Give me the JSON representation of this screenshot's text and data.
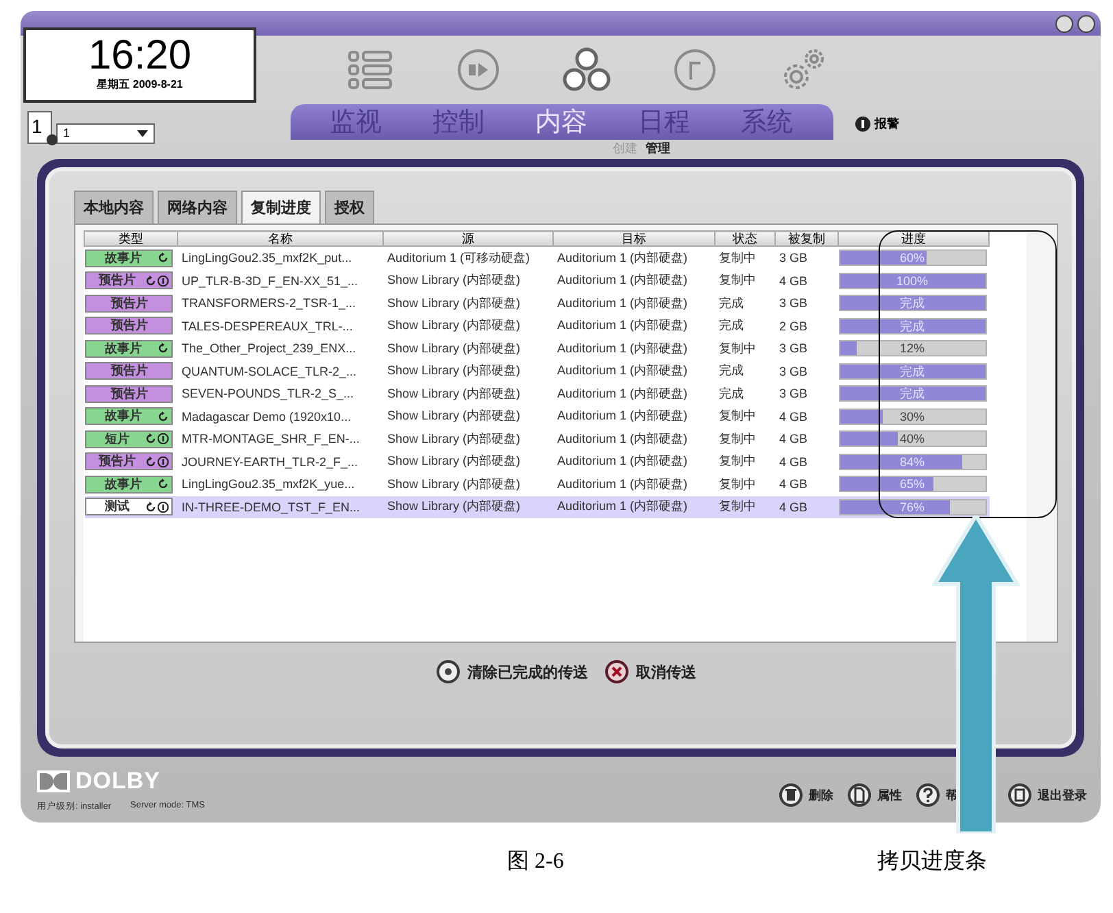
{
  "clock": {
    "time": "16:20",
    "date": "星期五 2009-8-21"
  },
  "screen_selector": {
    "number": "1",
    "value": "1"
  },
  "nav": [
    {
      "label": "监视",
      "kind": "list",
      "selected": false
    },
    {
      "label": "控制",
      "kind": "play",
      "selected": false
    },
    {
      "label": "内容",
      "kind": "content",
      "selected": true
    },
    {
      "label": "日程",
      "kind": "schedule",
      "selected": false
    },
    {
      "label": "系统",
      "kind": "settings",
      "selected": false
    }
  ],
  "sub_tabs": [
    {
      "label": "创建",
      "selected": false
    },
    {
      "label": "管理",
      "selected": true
    }
  ],
  "alarm": {
    "label": "报警"
  },
  "content_tabs": [
    {
      "label": "本地内容",
      "selected": false
    },
    {
      "label": "网络内容",
      "selected": false
    },
    {
      "label": "复制进度",
      "selected": true
    },
    {
      "label": "授权",
      "selected": false
    }
  ],
  "table": {
    "columns": [
      "类型",
      "名称",
      "源",
      "目标",
      "状态",
      "被复制",
      "进度"
    ],
    "rows": [
      {
        "type": "故事片",
        "color": "#86d68f",
        "loop": true,
        "info": false,
        "name": "LingLingGou2.35_mxf2K_put...",
        "source": "Auditorium 1 (可移动硬盘)",
        "target": "Auditorium 1 (内部硬盘)",
        "status": "复制中",
        "copied": "3 GB",
        "progress": "60%",
        "level": 0.6,
        "selected": false
      },
      {
        "type": "预告片",
        "color": "#c58fe0",
        "loop": true,
        "info": true,
        "name": "UP_TLR-B-3D_F_EN-XX_51_...",
        "source": "Show Library (内部硬盘)",
        "target": "Auditorium 1 (内部硬盘)",
        "status": "复制中",
        "copied": "4 GB",
        "progress": "100%",
        "level": 1,
        "selected": false
      },
      {
        "type": "预告片",
        "color": "#c58fe0",
        "loop": false,
        "info": false,
        "name": "TRANSFORMERS-2_TSR-1_...",
        "source": "Show Library (内部硬盘)",
        "target": "Auditorium 1 (内部硬盘)",
        "status": "完成",
        "copied": "3 GB",
        "progress": "完成",
        "level": 1,
        "selected": false
      },
      {
        "type": "预告片",
        "color": "#c58fe0",
        "loop": false,
        "info": false,
        "name": "TALES-DESPEREAUX_TRL-...",
        "source": "Show Library (内部硬盘)",
        "target": "Auditorium 1 (内部硬盘)",
        "status": "完成",
        "copied": "2 GB",
        "progress": "完成",
        "level": 1,
        "selected": false
      },
      {
        "type": "故事片",
        "color": "#86d68f",
        "loop": true,
        "info": false,
        "name": "The_Other_Project_239_ENX...",
        "source": "Show Library (内部硬盘)",
        "target": "Auditorium 1 (内部硬盘)",
        "status": "复制中",
        "copied": "3 GB",
        "progress": "12%",
        "level": 0.12,
        "selected": false
      },
      {
        "type": "预告片",
        "color": "#c58fe0",
        "loop": false,
        "info": false,
        "name": "QUANTUM-SOLACE_TLR-2_...",
        "source": "Show Library (内部硬盘)",
        "target": "Auditorium 1 (内部硬盘)",
        "status": "完成",
        "copied": "3 GB",
        "progress": "完成",
        "level": 1,
        "selected": false
      },
      {
        "type": "预告片",
        "color": "#c58fe0",
        "loop": false,
        "info": false,
        "name": "SEVEN-POUNDS_TLR-2_S_...",
        "source": "Show Library (内部硬盘)",
        "target": "Auditorium 1 (内部硬盘)",
        "status": "完成",
        "copied": "3 GB",
        "progress": "完成",
        "level": 1,
        "selected": false
      },
      {
        "type": "故事片",
        "color": "#86d68f",
        "loop": true,
        "info": false,
        "name": "Madagascar Demo (1920x10...",
        "source": "Show Library (内部硬盘)",
        "target": "Auditorium 1 (内部硬盘)",
        "status": "复制中",
        "copied": "4 GB",
        "progress": "30%",
        "level": 0.3,
        "selected": false
      },
      {
        "type": "短片",
        "color": "#86d68f",
        "loop": true,
        "info": true,
        "name": "MTR-MONTAGE_SHR_F_EN-...",
        "source": "Show Library (内部硬盘)",
        "target": "Auditorium 1 (内部硬盘)",
        "status": "复制中",
        "copied": "4 GB",
        "progress": "40%",
        "level": 0.4,
        "selected": false
      },
      {
        "type": "预告片",
        "color": "#c58fe0",
        "loop": true,
        "info": true,
        "name": "JOURNEY-EARTH_TLR-2_F_...",
        "source": "Show Library (内部硬盘)",
        "target": "Auditorium 1 (内部硬盘)",
        "status": "复制中",
        "copied": "4 GB",
        "progress": "84%",
        "level": 0.84,
        "selected": false
      },
      {
        "type": "故事片",
        "color": "#86d68f",
        "loop": true,
        "info": false,
        "name": "LingLingGou2.35_mxf2K_yue...",
        "source": "Show Library (内部硬盘)",
        "target": "Auditorium 1 (内部硬盘)",
        "status": "复制中",
        "copied": "4 GB",
        "progress": "65%",
        "level": 0.65,
        "selected": false
      },
      {
        "type": "测试",
        "color": "#ffffff",
        "loop": true,
        "info": true,
        "name": "IN-THREE-DEMO_TST_F_EN...",
        "source": "Show Library (内部硬盘)",
        "target": "Auditorium 1 (内部硬盘)",
        "status": "复制中",
        "copied": "4 GB",
        "progress": "76%",
        "level": 0.76,
        "selected": true
      }
    ]
  },
  "actions": [
    {
      "kind": "clear",
      "label": "清除已完成的传送"
    },
    {
      "kind": "cancel",
      "label": "取消传送"
    }
  ],
  "footer": {
    "logo": "DOLBY",
    "user": "用户级别: installer",
    "server": "Server mode: TMS",
    "buttons": [
      {
        "kind": "delete",
        "label": "删除"
      },
      {
        "kind": "properties",
        "label": "属性"
      },
      {
        "kind": "help",
        "label": "帮"
      },
      {
        "kind": "logout",
        "label": "退出登录"
      }
    ]
  },
  "caption": {
    "figure": "图 2-6",
    "title": "拷贝进度条"
  }
}
